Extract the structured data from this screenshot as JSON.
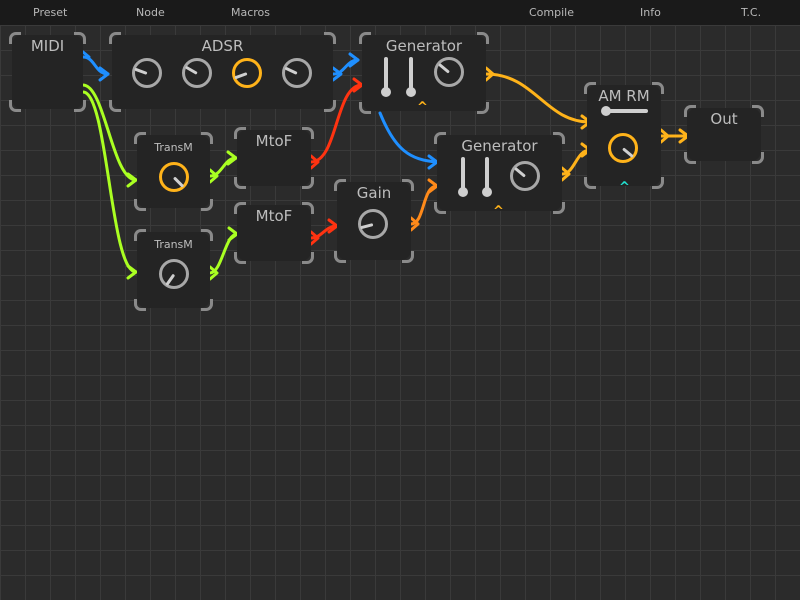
{
  "menu": {
    "preset": "Preset",
    "node": "Node",
    "macros": "Macros",
    "compile": "Compile",
    "info": "Info",
    "tc": "T.C."
  },
  "nodes": {
    "midi": {
      "title": "MIDI"
    },
    "adsr": {
      "title": "ADSR"
    },
    "generator1": {
      "title": "Generator"
    },
    "generator2": {
      "title": "Generator"
    },
    "transm1": {
      "title": "TransM"
    },
    "transm2": {
      "title": "TransM"
    },
    "mtof1": {
      "title": "MtoF"
    },
    "mtof2": {
      "title": "MtoF"
    },
    "gain": {
      "title": "Gain"
    },
    "amrm": {
      "title": "AM RM"
    },
    "out": {
      "title": "Out"
    }
  },
  "colors": {
    "background": "#2b2b2b",
    "node": "#242424",
    "knob_active": "#ffb31a",
    "wire_blue": "#1f8fff",
    "wire_green": "#aaff22",
    "wire_red": "#ff3311",
    "wire_orange": "#ff8a1a",
    "wire_amber": "#ffb31a",
    "caret_teal": "#22e0d0"
  }
}
